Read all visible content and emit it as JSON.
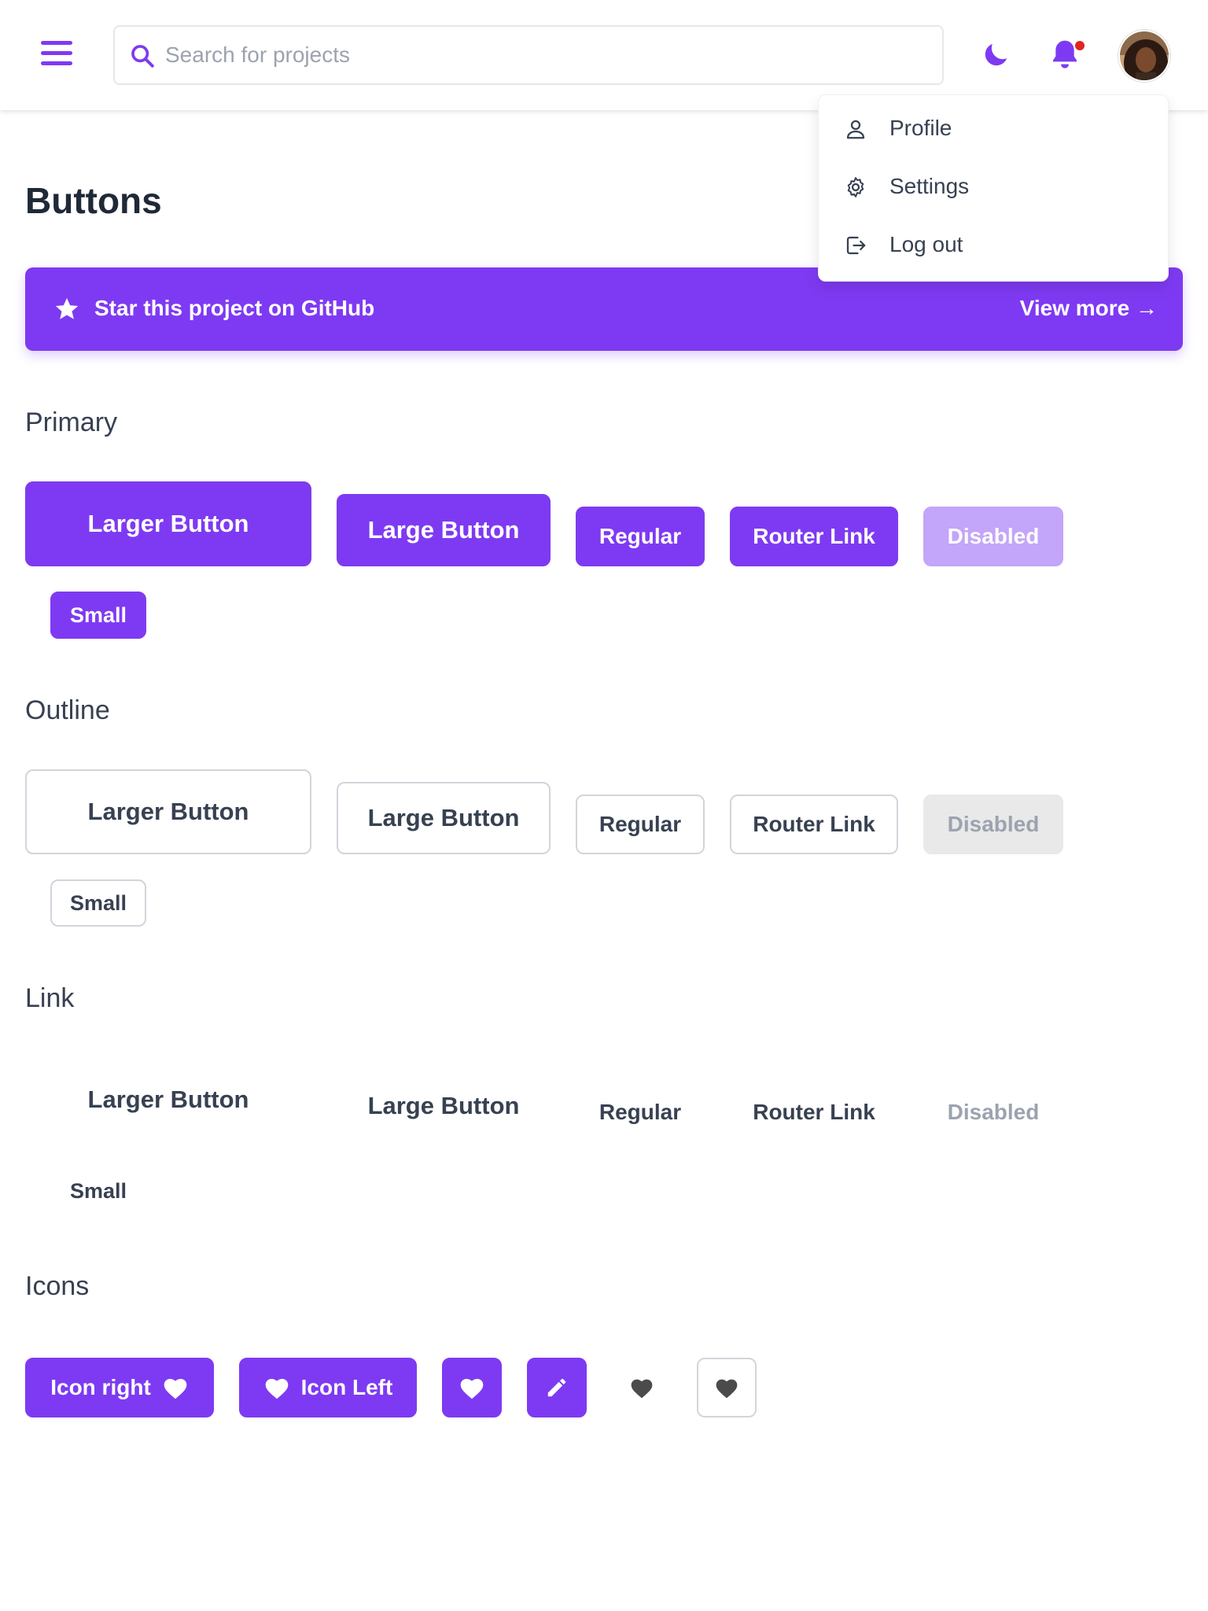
{
  "header": {
    "search_placeholder": "Search for projects",
    "menu_icon": "hamburger-menu-icon",
    "theme_icon": "moon-icon",
    "notification_icon": "bell-icon",
    "accent_color": "#7e3af2"
  },
  "user_menu": {
    "items": [
      {
        "label": "Profile",
        "icon": "user-icon"
      },
      {
        "label": "Settings",
        "icon": "gear-icon"
      },
      {
        "label": "Log out",
        "icon": "logout-icon"
      }
    ]
  },
  "page": {
    "title": "Buttons",
    "banner": {
      "text": "Star this project on GitHub",
      "link": "View more →"
    }
  },
  "sections": {
    "primary": {
      "title": "Primary",
      "larger": "Larger Button",
      "large": "Large Button",
      "regular": "Regular",
      "router": "Router Link",
      "disabled": "Disabled",
      "small": "Small"
    },
    "outline": {
      "title": "Outline",
      "larger": "Larger Button",
      "large": "Large Button",
      "regular": "Regular",
      "router": "Router Link",
      "disabled": "Disabled",
      "small": "Small"
    },
    "link": {
      "title": "Link",
      "larger": "Larger Button",
      "large": "Large Button",
      "regular": "Regular",
      "router": "Router Link",
      "disabled": "Disabled",
      "small": "Small"
    },
    "icons": {
      "title": "Icons",
      "icon_right": "Icon right",
      "icon_left": "Icon Left"
    }
  }
}
